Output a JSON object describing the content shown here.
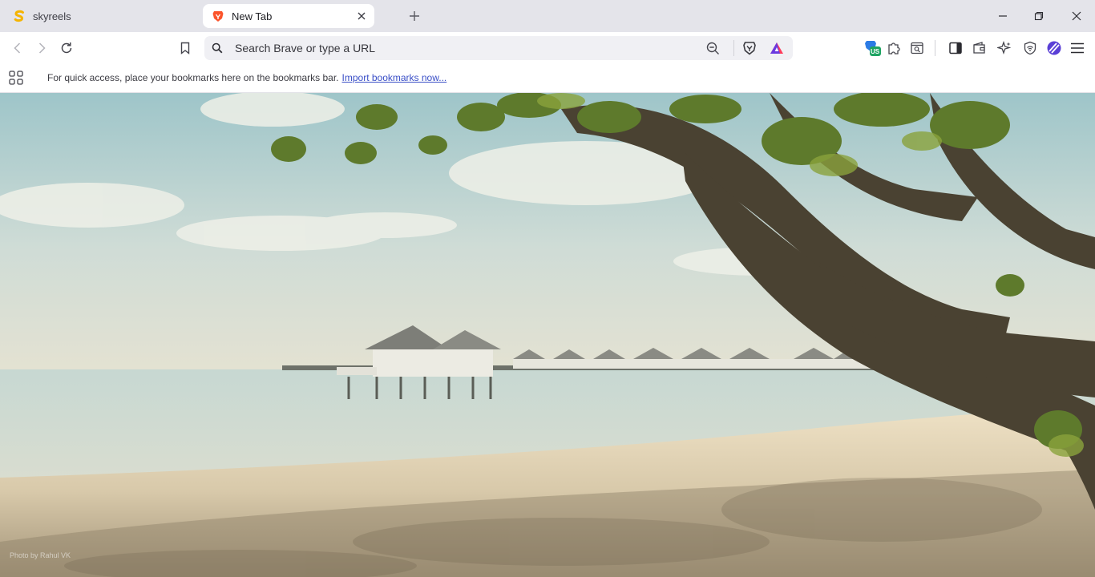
{
  "tabs": [
    {
      "title": "skyreels",
      "active": false
    },
    {
      "title": "New Tab",
      "active": true
    }
  ],
  "omnibox": {
    "placeholder": "Search Brave or type a URL"
  },
  "bookmarks_bar": {
    "message": "For quick access, place your bookmarks here on the bookmarks bar.",
    "link": "Import bookmarks now..."
  },
  "extensions": {
    "vpn_badge": "US"
  },
  "background": {
    "photo_credit": "Photo by Rahul VK"
  },
  "colors": {
    "brave_orange": "#fb542b",
    "skyreels_yellow": "#f5b400",
    "vpn_green": "#1fa463",
    "link_blue": "#3a4fc7"
  }
}
